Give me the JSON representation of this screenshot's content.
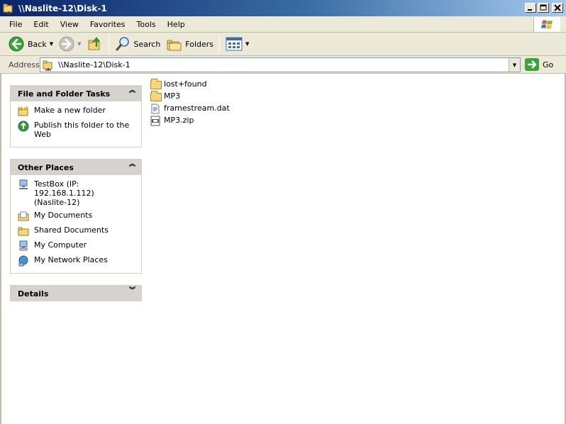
{
  "window": {
    "title": "\\\\Naslite-12\\Disk-1"
  },
  "menubar": {
    "items": [
      "File",
      "Edit",
      "View",
      "Favorites",
      "Tools",
      "Help"
    ]
  },
  "toolbar": {
    "back_label": "Back",
    "search_label": "Search",
    "folders_label": "Folders"
  },
  "address": {
    "label": "Address",
    "value": "\\\\Naslite-12\\Disk-1",
    "go_label": "Go"
  },
  "left_pane": {
    "file_tasks": {
      "title": "File and Folder Tasks",
      "items": [
        {
          "label": "Make a new folder",
          "icon": "new-folder-icon"
        },
        {
          "label": "Publish this folder to the Web",
          "icon": "publish-web-icon"
        }
      ]
    },
    "other_places": {
      "title": "Other Places",
      "items": [
        {
          "label": "TestBox (IP: 192.168.1.112) (Naslite-12)",
          "icon": "network-computer-icon"
        },
        {
          "label": "My Documents",
          "icon": "my-documents-icon"
        },
        {
          "label": "Shared Documents",
          "icon": "shared-documents-icon"
        },
        {
          "label": "My Computer",
          "icon": "my-computer-icon"
        },
        {
          "label": "My Network Places",
          "icon": "network-places-icon"
        }
      ]
    },
    "details": {
      "title": "Details"
    }
  },
  "files": [
    {
      "name": "lost+found",
      "icon": "folder-icon"
    },
    {
      "name": "MP3",
      "icon": "folder-icon"
    },
    {
      "name": "framestream.dat",
      "icon": "data-file-icon"
    },
    {
      "name": "MP3.zip",
      "icon": "zip-file-icon"
    }
  ]
}
